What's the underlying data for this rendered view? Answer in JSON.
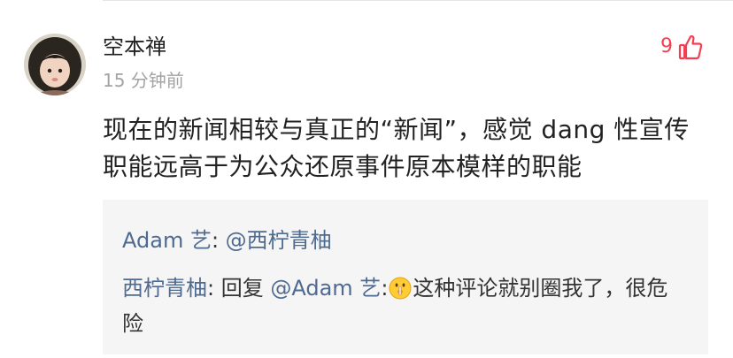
{
  "comment": {
    "author": "空本禅",
    "time": "15 分钟前",
    "likes": "9",
    "text": "现在的新闻相较与真正的“新闻”，感觉 dang 性宣传职能远高于为公众还原事件原本模样的职能"
  },
  "replies": [
    {
      "author": "Adam 艺",
      "separator": ": ",
      "mention": "@西柠青柚"
    },
    {
      "author": "西柠青柚",
      "separator": ": ",
      "prefix": "回复 ",
      "mention": "@Adam 艺",
      "after_mention": ":",
      "emoji": "shush-emoji",
      "text": "这种评论就别圈我了，很危险"
    }
  ],
  "colors": {
    "like": "#f23f51",
    "link": "#4e6a91",
    "reply_bg": "#f5f5f5",
    "meta": "#a3a3a3"
  },
  "icons": {
    "like": "thumbs-up-icon",
    "avatar": "avatar-photo"
  }
}
